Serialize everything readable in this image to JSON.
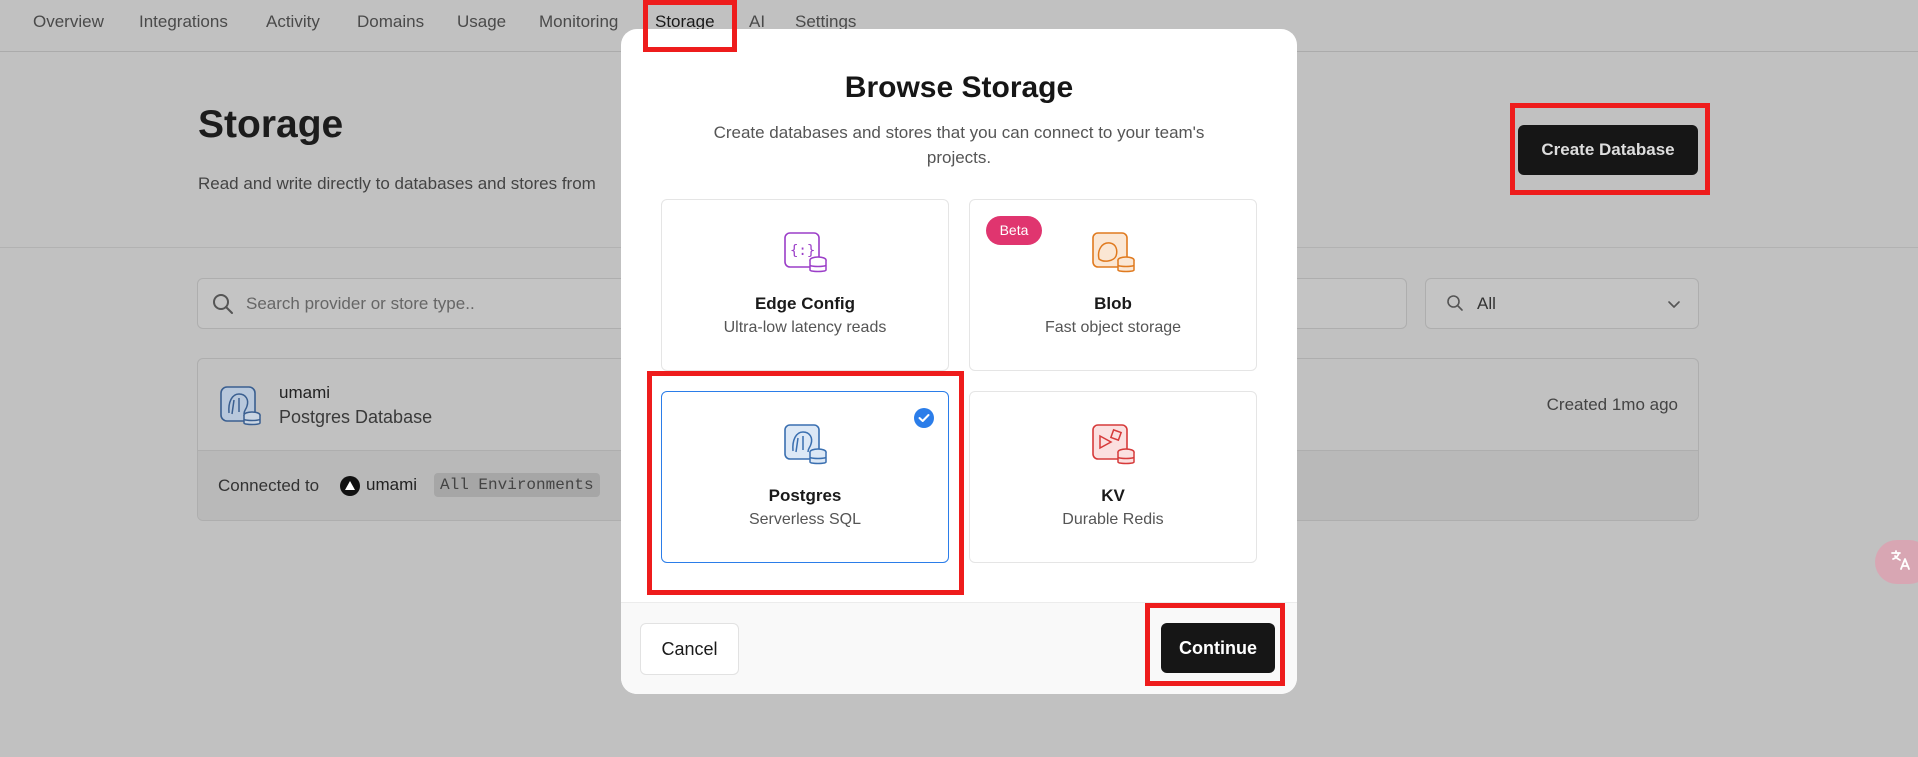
{
  "nav": {
    "tabs": [
      "Overview",
      "Integrations",
      "Activity",
      "Domains",
      "Usage",
      "Monitoring",
      "Storage",
      "AI",
      "Settings"
    ],
    "active": "Storage"
  },
  "page": {
    "title": "Storage",
    "description": "Read and write directly to databases and stores from",
    "create_button": "Create Database"
  },
  "search": {
    "placeholder": "Search provider or store type.."
  },
  "filter": {
    "value": "All"
  },
  "store": {
    "name": "umami",
    "type": "Postgres Database",
    "created": "Created 1mo ago",
    "connected_label": "Connected to",
    "project": "umami",
    "environments": "All Environments"
  },
  "modal": {
    "title": "Browse Storage",
    "description": "Create databases and stores that you can connect to your team's projects.",
    "options": [
      {
        "name": "Edge Config",
        "subtitle": "Ultra-low latency reads",
        "icon": "edge-config-icon",
        "color": "#9b3ec8"
      },
      {
        "name": "Blob",
        "subtitle": "Fast object storage",
        "icon": "blob-icon",
        "color": "#e07a1f",
        "badge": "Beta"
      },
      {
        "name": "Postgres",
        "subtitle": "Serverless SQL",
        "icon": "postgres-icon",
        "color": "#3a6fb0",
        "selected": true
      },
      {
        "name": "KV",
        "subtitle": "Durable Redis",
        "icon": "kv-icon",
        "color": "#d63a3a"
      }
    ],
    "cancel": "Cancel",
    "continue": "Continue"
  },
  "colors": {
    "accent_blue": "#2b7de9",
    "beta_pink": "#e0356f",
    "button_dark": "#161616",
    "highlight_red": "#ee1c1c"
  }
}
